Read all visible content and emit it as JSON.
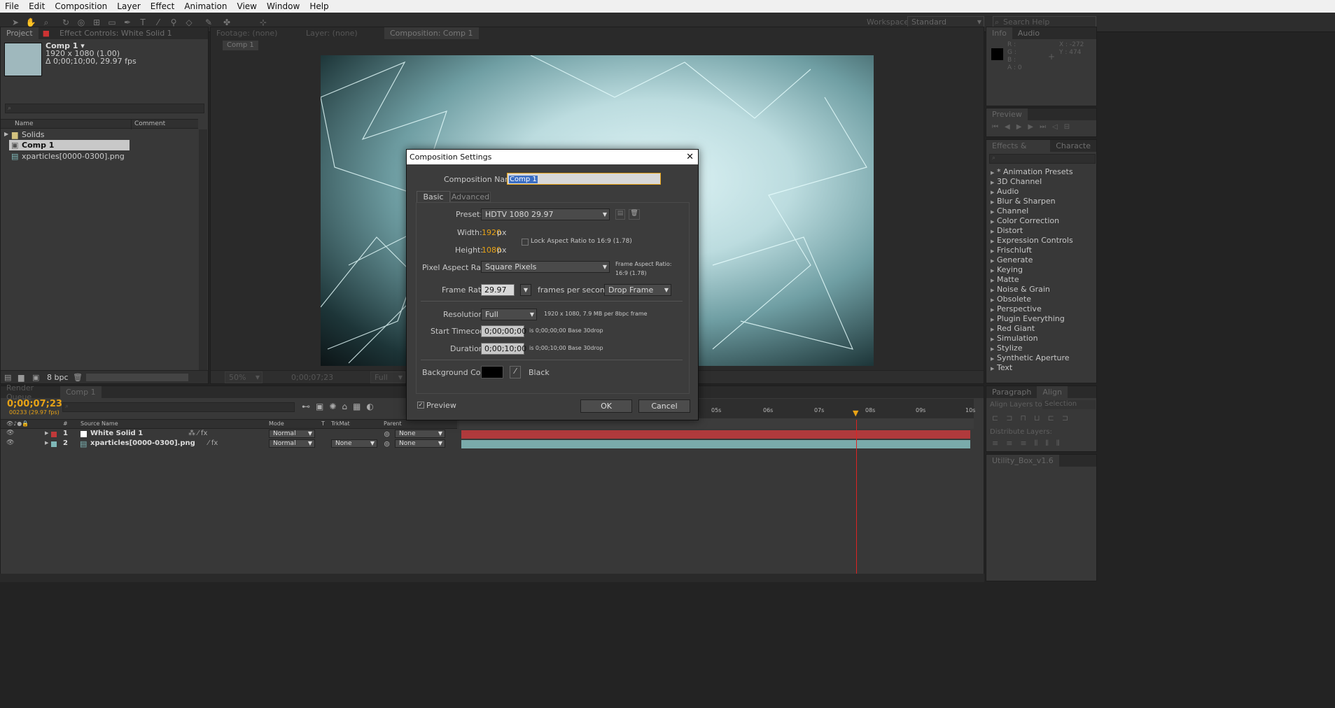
{
  "menu": [
    "File",
    "Edit",
    "Composition",
    "Layer",
    "Effect",
    "Animation",
    "View",
    "Window",
    "Help"
  ],
  "toolbar": {
    "workspace_label": "Workspace:",
    "workspace_value": "Standard",
    "search_placeholder": "Search Help"
  },
  "project": {
    "tab_project": "Project",
    "tab_effect_controls": "Effect Controls: White Solid 1",
    "comp_name": "Comp 1 ▾",
    "comp_res": "1920 x 1080 (1.00)",
    "comp_duration": "Δ 0;00;10;00, 29.97 fps",
    "col_name": "Name",
    "col_comment": "Comment",
    "items": [
      {
        "label": "Solids",
        "icon": "folder-icon"
      },
      {
        "label": "Comp 1",
        "icon": "composition-icon"
      },
      {
        "label": "xparticles[0000-0300].png",
        "icon": "image-sequence-icon"
      }
    ],
    "bpc": "8 bpc"
  },
  "viewer": {
    "tab_footage": "Footage: (none)",
    "tab_layer": "Layer: (none)",
    "tab_comp": "Composition: Comp 1",
    "crumb": "Comp 1",
    "zoom": "50%",
    "timecode": "0;00;07;23",
    "resolution": "Full"
  },
  "info": {
    "tab_info": "Info",
    "tab_audio": "Audio",
    "r": "R :",
    "g": "G :",
    "b": "B :",
    "a": "A : 0",
    "x": "X : -272",
    "y": "Y : 474"
  },
  "preview": {
    "tab": "Preview"
  },
  "effects": {
    "tab": "Effects & Presets",
    "tab2": "Characte",
    "items": [
      "* Animation Presets",
      "3D Channel",
      "Audio",
      "Blur & Sharpen",
      "Channel",
      "Color Correction",
      "Distort",
      "Expression Controls",
      "Frischluft",
      "Generate",
      "Keying",
      "Matte",
      "Noise & Grain",
      "Obsolete",
      "Perspective",
      "Plugin Everything",
      "Red Giant",
      "Simulation",
      "Stylize",
      "Synthetic Aperture",
      "Text"
    ]
  },
  "align": {
    "tab_para": "Paragraph",
    "tab_align": "Align",
    "align_to": "Align Layers to:",
    "align_to_value": "Selection",
    "distribute": "Distribute Layers:",
    "utility": "Utility_Box_v1.6"
  },
  "timeline": {
    "tab_render": "Render Queue",
    "tab_comp": "Comp 1",
    "timecode": "0;00;07;23",
    "frame": "00233 (29.97 fps)",
    "cols": {
      "num": "#",
      "source": "Source Name",
      "mode": "Mode",
      "t": "T",
      "trkmat": "TrkMat",
      "parent": "Parent"
    },
    "layers": [
      {
        "num": "1",
        "name": "White Solid 1",
        "mode": "Normal",
        "trkmat": "",
        "parent": "None",
        "color": "#c0393a"
      },
      {
        "num": "2",
        "name": "xparticles[0000-0300].png",
        "mode": "Normal",
        "trkmat": "None",
        "parent": "None",
        "color": "#7fb8b8"
      }
    ],
    "ruler": [
      "05s",
      "06s",
      "07s",
      "08s",
      "09s",
      "10s"
    ]
  },
  "dialog": {
    "title": "Composition Settings",
    "comp_name_label": "Composition Name:",
    "comp_name_value": "Comp 1",
    "tab_basic": "Basic",
    "tab_advanced": "Advanced",
    "preset_label": "Preset:",
    "preset_value": "HDTV 1080 29.97",
    "width_label": "Width:",
    "width_value": "1920",
    "px": "px",
    "height_label": "Height:",
    "height_value": "1080",
    "lock_label": "Lock Aspect Ratio to 16:9 (1.78)",
    "par_label": "Pixel Aspect Ratio:",
    "par_value": "Square Pixels",
    "far_label": "Frame Aspect Ratio:",
    "far_value": "16:9 (1.78)",
    "fr_label": "Frame Rate:",
    "fr_value": "29.97",
    "fps": "frames per second",
    "drop": "Drop Frame",
    "res_label": "Resolution:",
    "res_value": "Full",
    "res_info": "1920 x 1080, 7.9 MB per 8bpc frame",
    "start_label": "Start Timecode:",
    "start_value": "0;00;00;00",
    "start_info": "is 0;00;00;00  Base 30drop",
    "dur_label": "Duration:",
    "dur_value": "0;00;10;00",
    "dur_info": "is 0;00;10;00  Base 30drop",
    "bg_label": "Background Color:",
    "bg_name": "Black",
    "preview": "Preview",
    "ok": "OK",
    "cancel": "Cancel"
  }
}
